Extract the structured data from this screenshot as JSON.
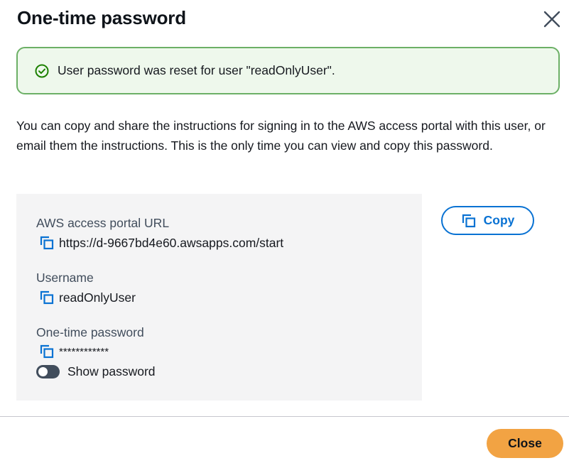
{
  "dialog": {
    "title": "One-time password",
    "close_icon": "close-icon"
  },
  "alert": {
    "type": "success",
    "icon": "check-circle-icon",
    "message": "User password was reset for user \"readOnlyUser\"."
  },
  "intro": "You can copy and share the instructions for signing in to the AWS access portal with this user, or email them the instructions. This is the only time you can view and copy this password.",
  "fields": {
    "portal_url": {
      "label": "AWS access portal URL",
      "value": "https://d-9667bd4e60.awsapps.com/start",
      "icon": "copy-icon"
    },
    "username": {
      "label": "Username",
      "value": "readOnlyUser",
      "icon": "copy-icon"
    },
    "password": {
      "label": "One-time password",
      "value": "************",
      "icon": "copy-icon"
    }
  },
  "toggle": {
    "label": "Show password",
    "checked": false
  },
  "copy_button": {
    "label": "Copy",
    "icon": "copy-icon"
  },
  "footer": {
    "close_label": "Close"
  },
  "colors": {
    "accent": "#0972d3",
    "success_border": "#6cb066",
    "success_bg": "#eef8ec",
    "primary_button": "#f2a343",
    "panel_bg": "#f4f4f5"
  }
}
